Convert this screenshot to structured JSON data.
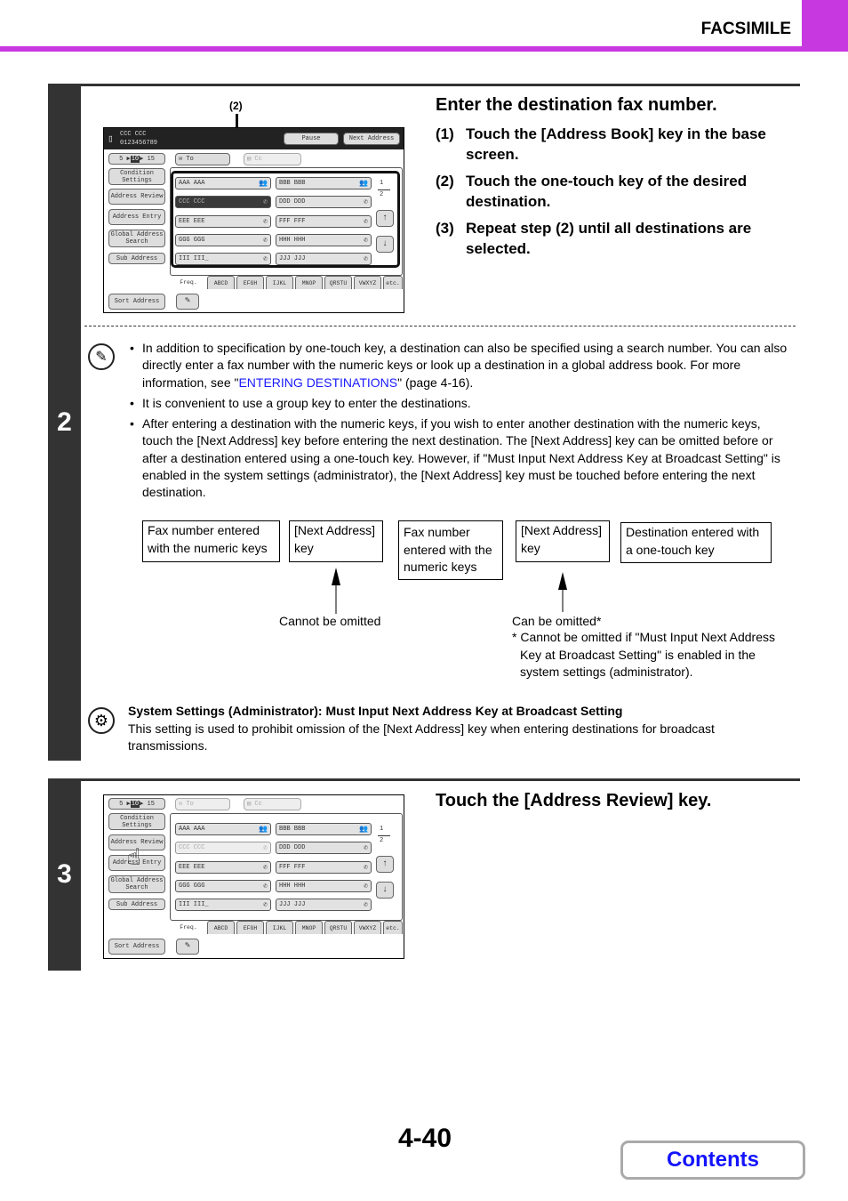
{
  "header": {
    "section": "FACSIMILE"
  },
  "step2": {
    "number": "2",
    "heading": "Enter the destination fax number.",
    "substeps": [
      {
        "num": "(1)",
        "text": "Touch the [Address Book] key in the base screen."
      },
      {
        "num": "(2)",
        "text": "Touch the one-touch key of the desired destination."
      },
      {
        "num": "(3)",
        "text": "Repeat step (2) until all destinations are selected."
      }
    ],
    "callout": "(2)",
    "panel": {
      "name": "CCC CCC",
      "number": "0123456789",
      "pause": "Pause",
      "next_address": "Next Address",
      "counter": {
        "a": "5",
        "b": "10",
        "c": "15"
      },
      "to": "To",
      "cc": "Cc",
      "side_buttons": [
        "Condition Settings",
        "Address Review",
        "Address Entry",
        "Global Address Search",
        "Sub Address"
      ],
      "sort_address": "Sort Address",
      "keys": [
        {
          "label": "AAA AAA",
          "icon": "group-icon"
        },
        {
          "label": "BBB BBB",
          "icon": "group-icon"
        },
        {
          "label": "CCC CCC",
          "icon": "phone-icon",
          "state": "selected"
        },
        {
          "label": "DDD DDD",
          "icon": "phone-icon"
        },
        {
          "label": "EEE EEE",
          "icon": "phone-icon"
        },
        {
          "label": "FFF FFF",
          "icon": "phone-icon"
        },
        {
          "label": "GGG GGG",
          "icon": "phone-icon"
        },
        {
          "label": "HHH HHH",
          "icon": "phone-icon"
        },
        {
          "label": "III III_",
          "icon": "phone-icon"
        },
        {
          "label": "JJJ JJJ",
          "icon": "phone-icon"
        }
      ],
      "page": {
        "current": "1",
        "total": "2"
      },
      "tabs": [
        "Freq.",
        "ABCD",
        "EFGH",
        "IJKL",
        "MNOP",
        "QRSTU",
        "VWXYZ",
        "etc."
      ]
    },
    "notes": [
      {
        "pre": "In addition to specification by one-touch key, a destination can also be specified using a search number. You can also directly enter a fax number with the numeric keys or look up a destination in a global address book. For more information, see \"",
        "link": "ENTERING DESTINATIONS",
        "post": "\" (page 4-16)."
      },
      {
        "pre": "It is convenient to use a group key to enter the destinations."
      },
      {
        "pre": "After entering a destination with the numeric keys, if you wish to enter another destination with the numeric keys, touch the [Next Address] key before entering the next destination. The [Next Address] key can be omitted before or after a destination entered using a one-touch key. However, if \"Must Input Next Address Key at Broadcast Setting\" is enabled in the system settings (administrator), the [Next Address] key must be touched before entering the next destination."
      }
    ],
    "diagram": {
      "boxes": [
        "Fax number entered with the numeric keys",
        "[Next Address] key",
        "Fax number entered with the numeric keys",
        "[Next Address] key",
        "Destination entered with a one-touch key"
      ],
      "cannot_omit": "Cannot be omitted",
      "can_omit": "Can be omitted*",
      "footnote": "* Cannot be omitted if \"Must Input Next Address Key at Broadcast Setting\" is enabled in the system settings (administrator)."
    },
    "system_settings": {
      "title": "System Settings (Administrator): Must Input Next Address Key at Broadcast Setting",
      "text": "This setting is used to prohibit omission of the [Next Address] key when entering destinations for broadcast transmissions."
    }
  },
  "step3": {
    "number": "3",
    "heading": "Touch the [Address Review] key."
  },
  "footer": {
    "page": "4-40",
    "contents": "Contents"
  }
}
